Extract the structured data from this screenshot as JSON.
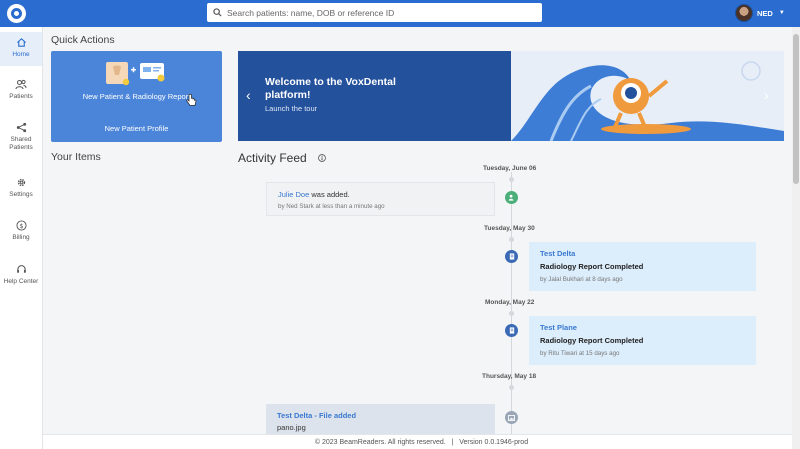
{
  "topbar": {
    "search_placeholder": "Search patients: name, DOB or reference ID",
    "user_name": "NED",
    "caret": "▼"
  },
  "sidebar": {
    "items": [
      {
        "label": "Home",
        "icon": "home-icon"
      },
      {
        "label": "Patients",
        "icon": "patients-icon"
      },
      {
        "label": "Shared Patients",
        "icon": "share-icon"
      },
      {
        "label": "Settings",
        "icon": "gear-icon"
      },
      {
        "label": "Billing",
        "icon": "dollar-icon"
      },
      {
        "label": "Help Center",
        "icon": "headset-icon"
      }
    ]
  },
  "quick_actions": {
    "title": "Quick Actions",
    "primary_label": "New Patient & Radiology Report",
    "secondary_label": "New Patient Profile"
  },
  "your_items": {
    "title": "Your Items"
  },
  "banner": {
    "title": "Welcome to the VoxDental platform!",
    "link": "Launch the tour",
    "prev": "‹",
    "next": "›"
  },
  "activity_feed": {
    "title": "Activity Feed",
    "groups": [
      {
        "date": "Tuesday, June 06",
        "name": "Julie Doe",
        "action": " was added.",
        "meta": "by Ned Stark at less than a minute ago"
      },
      {
        "date": "Tuesday, May 30",
        "name": "Test Delta",
        "action": "Radiology Report Completed",
        "meta": "by Jalal Bukhari at 8 days ago"
      },
      {
        "date": "Monday, May 22",
        "name": "Test Plane",
        "action": "Radiology Report Completed",
        "meta": "by Ritu Tiwari at 15 days ago"
      },
      {
        "date": "Thursday, May 18",
        "name": "Test Delta - File added",
        "action": "pano.jpg",
        "meta": ""
      }
    ]
  },
  "footer": {
    "text": "© 2023 BeamReaders. All rights reserved.   |   Version 0.0.1946-prod"
  },
  "colors": {
    "topbar": "#2a6ccf",
    "accent": "#4a85d9",
    "success": "#4caf7a",
    "timeline_report": "#3a6ab5"
  }
}
